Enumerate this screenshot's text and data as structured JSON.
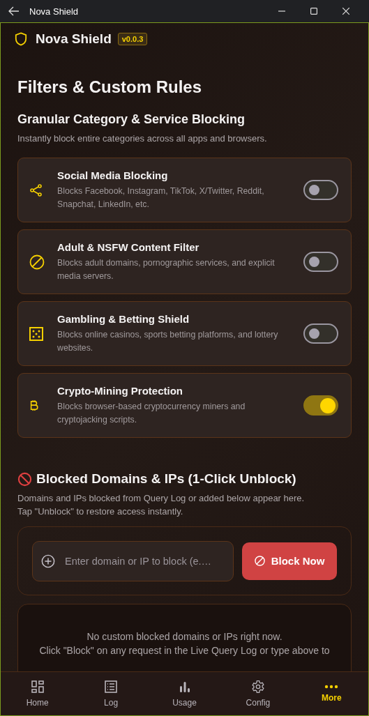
{
  "window": {
    "title": "Nova Shield"
  },
  "app": {
    "name": "Nova Shield",
    "version": "v0.0.3"
  },
  "page_title": "Filters & Custom Rules",
  "categories": {
    "heading": "Granular Category & Service Blocking",
    "description": "Instantly block entire categories across all apps and browsers.",
    "items": [
      {
        "title": "Social Media Blocking",
        "description": "Blocks Facebook, Instagram, TikTok, X/Twitter, Reddit, Snapchat, LinkedIn, etc.",
        "on": false
      },
      {
        "title": "Adult & NSFW Content Filter",
        "description": "Blocks adult domains, pornographic services, and explicit media servers.",
        "on": false
      },
      {
        "title": "Gambling & Betting Shield",
        "description": "Blocks online casinos, sports betting platforms, and lottery websites.",
        "on": false
      },
      {
        "title": "Crypto-Mining Protection",
        "description": "Blocks browser-based cryptocurrency miners and cryptojacking scripts.",
        "on": true
      }
    ]
  },
  "blocked": {
    "heading": "Blocked Domains & IPs (1-Click Unblock)",
    "description": "Domains and IPs blocked from Query Log or added below appear here. Tap \"Unblock\" to restore access instantly.",
    "input": {
      "placeholder": "Enter domain or IP to block (e.…"
    },
    "button": "Block Now",
    "empty": [
      "No custom blocked domains or IPs right now.",
      "Click \"Block\" on any request in the Live Query Log or type above to"
    ]
  },
  "nav": [
    {
      "label": "Home",
      "selected": false
    },
    {
      "label": "Log",
      "selected": false
    },
    {
      "label": "Usage",
      "selected": false
    },
    {
      "label": "Config",
      "selected": false
    },
    {
      "label": "More",
      "selected": true
    }
  ]
}
